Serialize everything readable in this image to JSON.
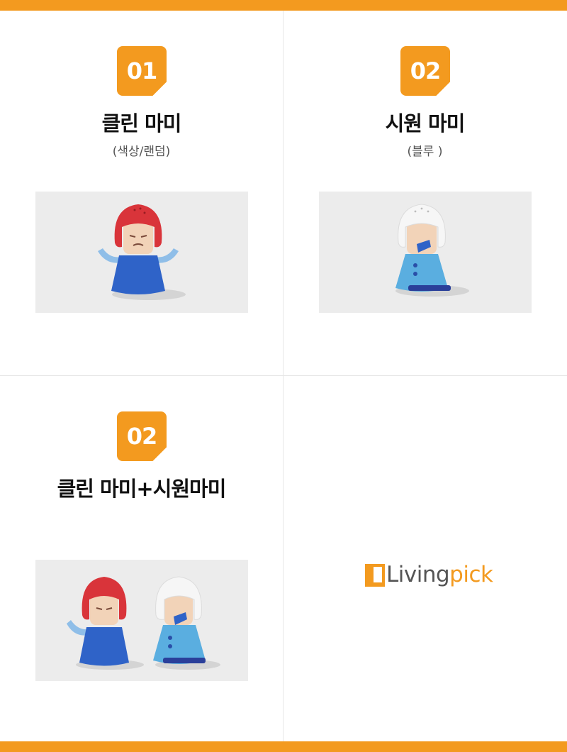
{
  "cards": [
    {
      "badge": "01",
      "title": "클린 마미",
      "subtitle": "(색상/랜덤)",
      "figures": [
        "red-mama"
      ]
    },
    {
      "badge": "02",
      "title": "시원 마미",
      "subtitle": "(블루 )",
      "figures": [
        "blue-mama"
      ]
    },
    {
      "badge": "02",
      "title": "클린 마미+시원마미",
      "subtitle": "",
      "figures": [
        "red-mama",
        "blue-mama"
      ]
    }
  ],
  "logo": {
    "text_main": "Living",
    "text_accent": "pick",
    "alt": "Livingpick"
  },
  "colors": {
    "accent": "#f39a1f",
    "photo_bg": "#ececec",
    "red_hair": "#d9343a",
    "blue_body": "#2f63c8",
    "light_blue_body": "#5aaee0"
  }
}
